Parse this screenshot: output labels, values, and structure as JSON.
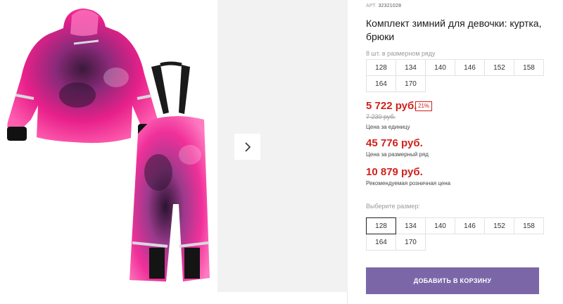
{
  "product": {
    "article_label": "АРТ.",
    "article_number": "32321028",
    "title": "Комплект зимний для девочки: куртка, брюки",
    "pack_note": "8 шт. в размерном ряду",
    "pack_sizes": [
      "128",
      "134",
      "140",
      "146",
      "152",
      "158",
      "164",
      "170"
    ]
  },
  "pricing": {
    "price_current": "5 722 руб.",
    "discount": "21%",
    "price_old": "7 230 руб.",
    "unit_label": "Цена за единицу",
    "price_row": "45 776 руб.",
    "row_label": "Цена за размерный ряд",
    "price_rrp": "10 879 руб.",
    "rrp_label": "Рекомендуемая розничная цена",
    "accent_color": "#d0211c"
  },
  "size_picker": {
    "label": "Выберите размер:",
    "sizes": [
      "128",
      "134",
      "140",
      "146",
      "152",
      "158",
      "164",
      "170"
    ],
    "selected": "128"
  },
  "cart": {
    "button_label": "ДОБАВИТЬ В КОРЗИНУ",
    "button_color": "#7b67a8"
  },
  "gallery": {
    "next_icon": "chevron-right-icon",
    "image_alt": "pink-galaxy-print-jacket-and-bib-pants"
  }
}
